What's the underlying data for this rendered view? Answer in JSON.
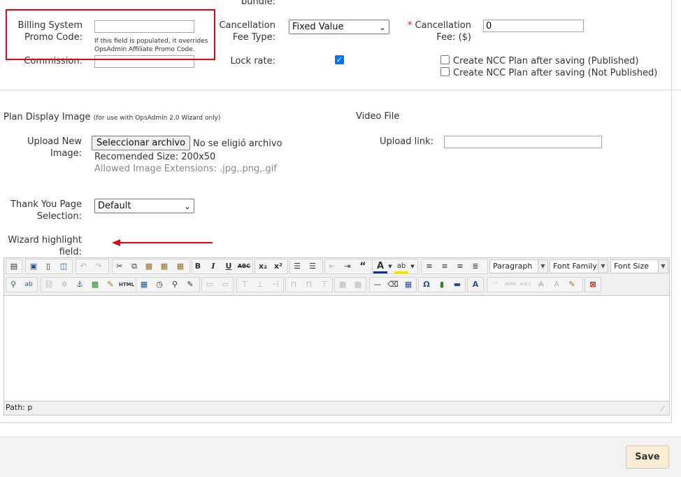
{
  "top": {
    "bundle_label": "bundle:",
    "billing_promo_label": "Billing System Promo Code:",
    "billing_promo_value": "",
    "billing_promo_hint": "If this field is populated, it overrides OpsAdmin Affiliate Promo Code.",
    "commission_label": "Commission:",
    "commission_value": "",
    "cancellation_fee_type_label": "Cancellation Fee Type:",
    "cancellation_fee_type_value": "Fixed Value",
    "cancellation_fee_label": "Cancellation Fee: ($)",
    "cancellation_fee_required": "*",
    "cancellation_fee_value": "0",
    "lock_rate_label": "Lock rate:",
    "lock_rate_checked": true,
    "ncc_published_label": "Create NCC Plan after saving (Published)",
    "ncc_not_published_label": "Create NCC Plan after saving (Not Published)"
  },
  "plan_image": {
    "title": "Plan Display Image",
    "subtitle": "(for use with OpsAdmin 2.0 Wizard only)",
    "upload_label": "Upload New Image:",
    "file_button": "Seleccionar archivo",
    "file_status": "No se eligió archivo",
    "size_hint": "Recomended Size: 200x50",
    "ext_hint": "Allowed Image Extensions: .jpg,.png,.gif"
  },
  "video": {
    "title": "Video File",
    "upload_link_label": "Upload link:",
    "upload_link_value": ""
  },
  "thank_you": {
    "label": "Thank You Page Selection:",
    "value": "Default"
  },
  "wizard": {
    "label": "Wizard highlight field:"
  },
  "editor": {
    "paragraph": "Paragraph",
    "font_family": "Font Family",
    "font_size": "Font Size",
    "path": "Path: p",
    "content": ""
  },
  "footer": {
    "save_label": "Save"
  },
  "colors": {
    "highlight_red": "#e30613",
    "checkbox_blue": "#0075ff",
    "save_bg": "#fbedd3"
  }
}
